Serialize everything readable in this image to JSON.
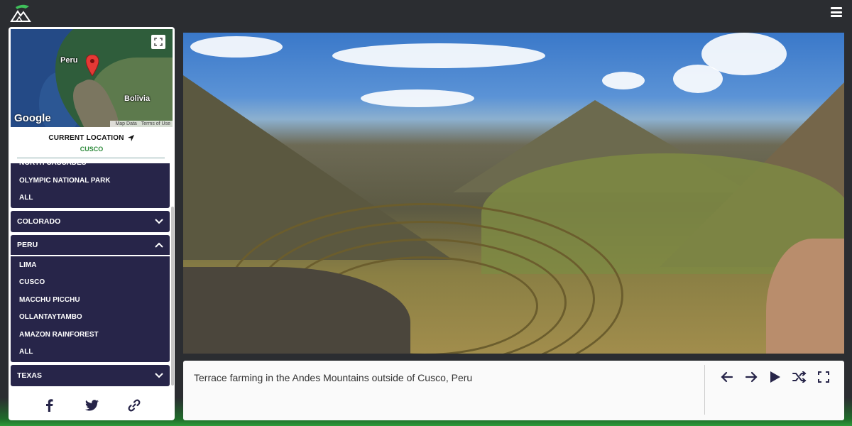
{
  "header": {
    "logo_icon": "mountain-logo-icon",
    "menu_icon": "hamburger-menu-icon"
  },
  "map": {
    "labels": {
      "peru": "Peru",
      "bolivia": "Bolivia"
    },
    "brand": "Google",
    "attribution": {
      "map_data": "Map Data",
      "terms": "Terms of Use"
    },
    "pin_icon": "map-pin-icon",
    "fullscreen_icon": "fullscreen-icon"
  },
  "current_location": {
    "label": "CURRENT LOCATION",
    "value": "CUSCO",
    "icon": "navigation-arrow-icon"
  },
  "locations": {
    "prev_group_items": [
      "NORTH CASCADES",
      "OLYMPIC NATIONAL PARK",
      "ALL"
    ],
    "groups": [
      {
        "name": "COLORADO",
        "open": false,
        "items": []
      },
      {
        "name": "PERU",
        "open": true,
        "items": [
          "LIMA",
          "CUSCO",
          "MACCHU PICCHU",
          "OLLANTAYTAMBO",
          "AMAZON RAINFOREST",
          "ALL"
        ]
      },
      {
        "name": "TEXAS",
        "open": false,
        "items": []
      }
    ]
  },
  "social": {
    "facebook_icon": "facebook-icon",
    "twitter_icon": "twitter-icon",
    "link_icon": "link-icon"
  },
  "photo": {
    "caption": "Terrace farming in the Andes Mountains outside of Cusco, Peru"
  },
  "controls": [
    "arrow-left-icon",
    "arrow-right-icon",
    "play-icon",
    "shuffle-icon",
    "fullscreen-icon"
  ],
  "colors": {
    "accent_navy": "#272549",
    "location_green": "#2e8b3c",
    "background_dark": "#2b2d31"
  }
}
